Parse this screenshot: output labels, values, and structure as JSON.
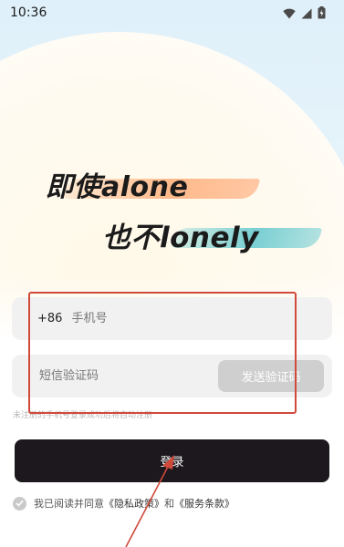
{
  "status_bar": {
    "time": "10:36"
  },
  "slogan": {
    "line1": "即使alone",
    "line2": "也不lonely"
  },
  "form": {
    "country_code": "+86",
    "phone_placeholder": "手机号",
    "code_placeholder": "短信验证码",
    "send_code_label": "发送验证码",
    "hint": "未注册的手机号登录成功后将自动注册",
    "login_label": "登录"
  },
  "agreement": {
    "prefix": "我已阅读并同意",
    "privacy_policy": "《隐私政策》",
    "and": "和",
    "terms_of_service": "《服务条款》"
  },
  "colors": {
    "login_button_bg": "#1c181d",
    "send_code_bg": "#cfcfcf",
    "annotation_red": "#d04a3c"
  }
}
